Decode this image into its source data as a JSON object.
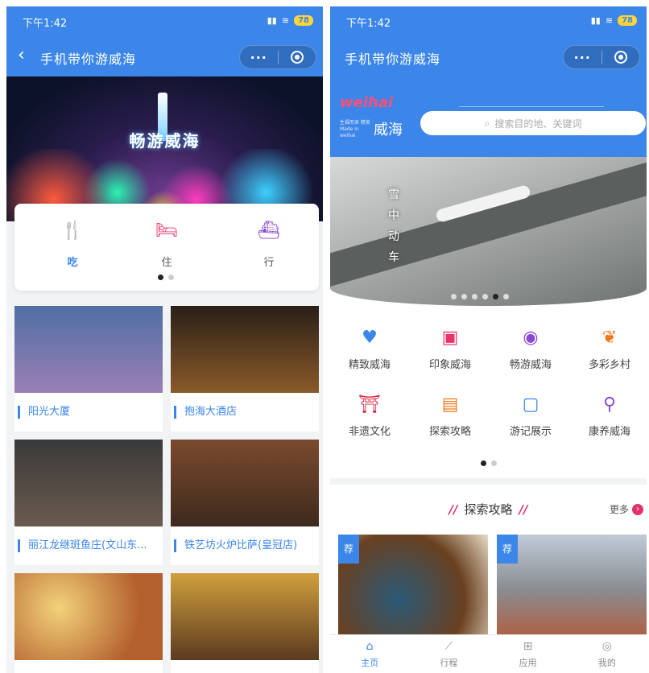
{
  "left": {
    "status": {
      "time": "下午1:42",
      "battery": "78"
    },
    "nav": {
      "back": "‹",
      "title": "手机带你游威海",
      "more": "···"
    },
    "banner": {
      "text": "畅游威海"
    },
    "categories": [
      {
        "label": "吃",
        "icon": "fork-knife-icon",
        "color": "#3b86e8"
      },
      {
        "label": "住",
        "icon": "bed-icon",
        "color": "#e8346a"
      },
      {
        "label": "行",
        "icon": "ship-icon",
        "color": "#8a4ad0"
      }
    ],
    "tiles": [
      {
        "name": "阳光大厦",
        "color": "#5c77a8"
      },
      {
        "name": "抱海大酒店",
        "color": "#4b3a2a"
      },
      {
        "name": "丽江龙继斑鱼庄(文山东...",
        "color": "#3a3330"
      },
      {
        "name": "铁艺坊火炉比萨(皇冠店)",
        "color": "#6b4a34"
      },
      {
        "name": "",
        "color": "#c89a52"
      },
      {
        "name": "",
        "color": "#8a5a2e"
      }
    ]
  },
  "right": {
    "status": {
      "time": "下午1:42",
      "battery": "78"
    },
    "nav": {
      "title": "手机带你游威海",
      "more": "···"
    },
    "logo": {
      "wave": "weihai",
      "name": "威海",
      "sub": "生福而来 精美 Made in weihai"
    },
    "search": {
      "placeholder": "搜索目的地、关键词"
    },
    "banner": {
      "vertical_text": "雪中动车"
    },
    "functions": [
      {
        "label": "精致威海",
        "icon": "heart-icon",
        "color": "#3b86e8"
      },
      {
        "label": "印象威海",
        "icon": "camera-icon",
        "color": "#e8346a"
      },
      {
        "label": "畅游威海",
        "icon": "lifebuoy-icon",
        "color": "#8a4ad0"
      },
      {
        "label": "多彩乡村",
        "icon": "leaf-icon",
        "color": "#f07a1e"
      },
      {
        "label": "非遗文化",
        "icon": "museum-icon",
        "color": "#d7263d"
      },
      {
        "label": "探索攻略",
        "icon": "book-icon",
        "color": "#f07a1e"
      },
      {
        "label": "游记展示",
        "icon": "badge-icon",
        "color": "#3b86e8"
      },
      {
        "label": "康养威海",
        "icon": "pin-icon",
        "color": "#8a4ad0"
      }
    ],
    "section": {
      "title": "探索攻略",
      "more": "更多"
    },
    "cards": [
      {
        "tag": "荐",
        "color": "#7a5030"
      },
      {
        "tag": "荐",
        "color": "#a0a6ae"
      }
    ],
    "tabs": [
      {
        "label": "主页",
        "icon": "home-icon",
        "active": true
      },
      {
        "label": "行程",
        "icon": "route-icon",
        "active": false
      },
      {
        "label": "应用",
        "icon": "grid-icon",
        "active": false
      },
      {
        "label": "我的",
        "icon": "user-icon",
        "active": false
      }
    ]
  }
}
